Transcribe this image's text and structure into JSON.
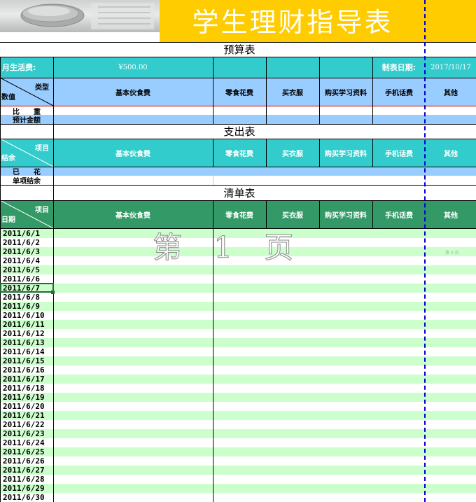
{
  "header": {
    "title": "学生理财指导表"
  },
  "budget": {
    "section_title": "预算表",
    "monthly_label": "月生活费:",
    "monthly_value": "¥500.00",
    "date_label": "制表日期:",
    "date_value": "2017/10/17",
    "diag_top": "类型",
    "diag_bottom": "数值",
    "columns": [
      "基本伙食费",
      "零食花费",
      "买衣服",
      "购买学习资料",
      "手机话费",
      "其他"
    ],
    "row_ratio": "比　　重",
    "row_estimate": "预计金额"
  },
  "expense": {
    "section_title": "支出表",
    "diag_top": "项目",
    "diag_bottom": "结余",
    "columns": [
      "基本伙食费",
      "零食花费",
      "买衣服",
      "购买学习资料",
      "手机话费",
      "其他"
    ],
    "row_spent": "已　　花",
    "row_balance": "单项结余"
  },
  "ledger": {
    "section_title": "清单表",
    "diag_top": "项目",
    "diag_bottom": "日期",
    "columns": [
      "基本伙食费",
      "零食花费",
      "买衣服",
      "购买学习资料",
      "手机话费",
      "其他"
    ],
    "dates": [
      "2011/6/1",
      "2011/6/2",
      "2011/6/3",
      "2011/6/4",
      "2011/6/5",
      "2011/6/6",
      "2011/6/7",
      "2011/6/8",
      "2011/6/9",
      "2011/6/10",
      "2011/6/11",
      "2011/6/12",
      "2011/6/13",
      "2011/6/14",
      "2011/6/15",
      "2011/6/16",
      "2011/6/17",
      "2011/6/18",
      "2011/6/19",
      "2011/6/20",
      "2011/6/21",
      "2011/6/22",
      "2011/6/23",
      "2011/6/24",
      "2011/6/25",
      "2011/6/26",
      "2011/6/27",
      "2011/6/28",
      "2011/6/29",
      "2011/6/30"
    ]
  },
  "watermark": {
    "text": "第 1 页",
    "small": "第 2 页"
  },
  "colors": {
    "title_band": "#ffcc00",
    "turquoise": "#33cccc",
    "light_blue": "#99ccff",
    "green": "#339966",
    "row_green": "#ccffcc",
    "page_break": "#0000cc"
  }
}
